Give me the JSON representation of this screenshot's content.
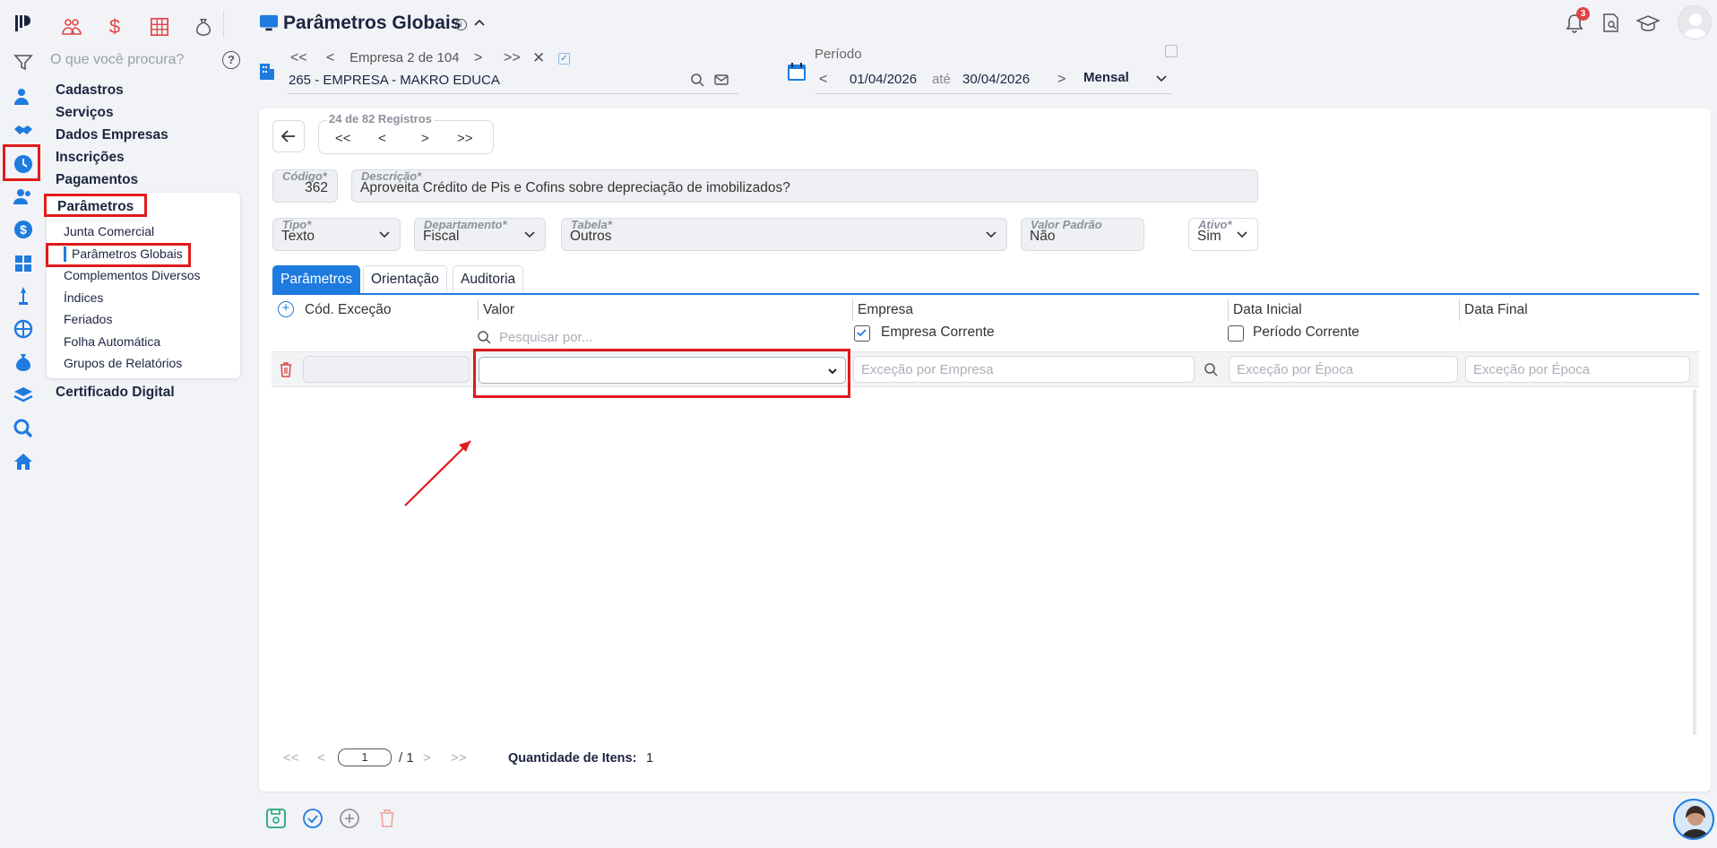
{
  "header": {
    "title": "Parâmetros Globais",
    "empresa_nav": "Empresa 2 de 104",
    "empresa_name": "265 - EMPRESA - MAKRO EDUCA",
    "periodo_label": "Período",
    "date_from": "01/04/2026",
    "ate": "até",
    "date_to": "30/04/2026",
    "periodicidade": "Mensal",
    "notifications_count": "3"
  },
  "nav": {
    "search_placeholder": "O que você procura?",
    "help": "?",
    "main": [
      "Cadastros",
      "Serviços",
      "Dados Empresas",
      "Inscrições",
      "Pagamentos",
      "Parâmetros",
      "Certificado Digital"
    ],
    "sub": [
      "Junta Comercial",
      "Parâmetros Globais",
      "Complementos Diversos",
      "Índices",
      "Feriados",
      "Folha Automática",
      "Grupos de Relatórios"
    ]
  },
  "record": {
    "nav_label": "24 de 82 Registros",
    "codigo_label": "Código*",
    "codigo": "362",
    "descricao_label": "Descrição*",
    "descricao": "Aproveita Crédito de Pis e Cofins sobre depreciação de imobilizados?",
    "tipo_label": "Tipo*",
    "tipo": "Texto",
    "departamento_label": "Departamento*",
    "departamento": "Fiscal",
    "tabela_label": "Tabela*",
    "tabela": "Outros",
    "valor_padrao_label": "Valor Padrão",
    "valor_padrao": "Não",
    "ativo_label": "Ativo*",
    "ativo": "Sim"
  },
  "tabs": [
    "Parâmetros",
    "Orientação",
    "Auditoria"
  ],
  "grid": {
    "columns": [
      "Cód. Exceção",
      "Valor",
      "Empresa",
      "Data Inicial",
      "Data Final"
    ],
    "search_placeholder": "Pesquisar por...",
    "empresa_corrente": "Empresa Corrente",
    "periodo_corrente": "Período Corrente",
    "excecao_empresa_placeholder": "Exceção por Empresa",
    "excecao_epoca_placeholder": "Exceção por Época"
  },
  "pager": {
    "page": "1",
    "total": "/ 1",
    "qtd_label": "Quantidade de Itens:",
    "qtd_value": "1"
  },
  "colors": {
    "accent": "#1e7be0",
    "highlight": "#e01b1b",
    "dark": "#1c2540"
  }
}
